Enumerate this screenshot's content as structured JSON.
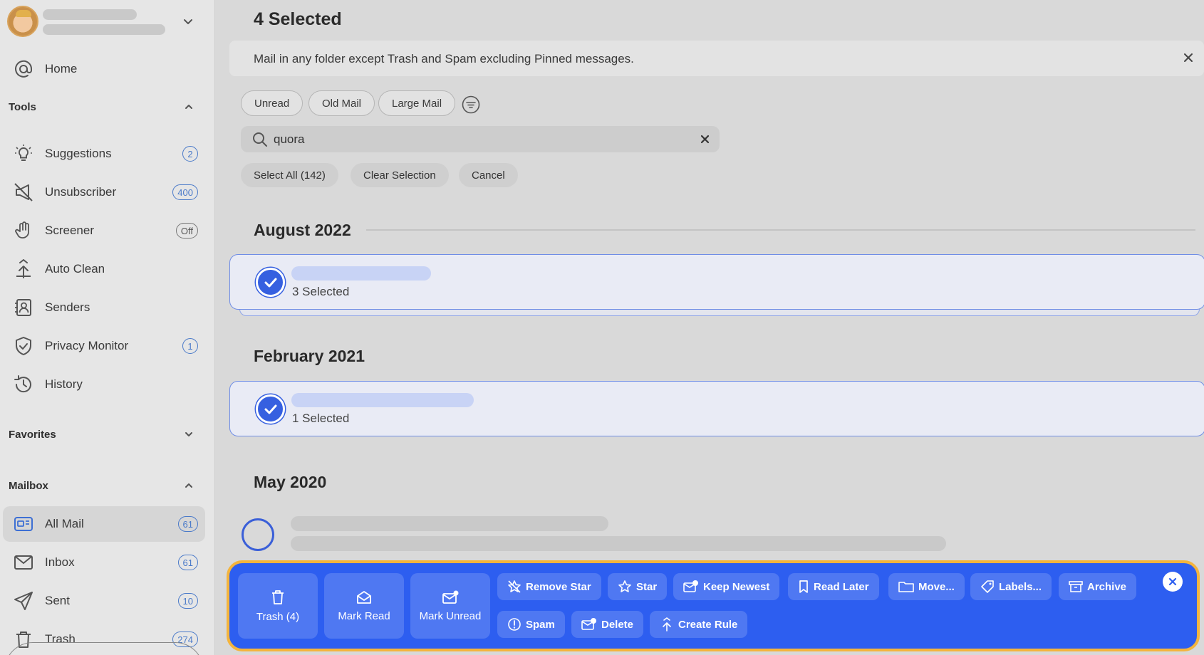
{
  "sidebar": {
    "home": {
      "label": "Home"
    },
    "tools": {
      "heading": "Tools",
      "items": [
        {
          "label": "Suggestions",
          "badge": "2"
        },
        {
          "label": "Unsubscriber",
          "badge": "400"
        },
        {
          "label": "Screener",
          "badge": "Off"
        },
        {
          "label": "Auto Clean",
          "badge": ""
        },
        {
          "label": "Senders",
          "badge": ""
        },
        {
          "label": "Privacy Monitor",
          "badge": "1"
        },
        {
          "label": "History",
          "badge": ""
        }
      ]
    },
    "favorites": {
      "heading": "Favorites"
    },
    "mailbox": {
      "heading": "Mailbox",
      "items": [
        {
          "label": "All Mail",
          "badge": "61"
        },
        {
          "label": "Inbox",
          "badge": "61"
        },
        {
          "label": "Sent",
          "badge": "10"
        },
        {
          "label": "Trash",
          "badge": "274"
        }
      ]
    }
  },
  "main": {
    "title": "4 Selected",
    "banner_text": "Mail in any folder except Trash and Spam excluding Pinned messages.",
    "filters": [
      "Unread",
      "Old Mail",
      "Large Mail"
    ],
    "search": {
      "value": "quora"
    },
    "selection_actions": [
      "Select All (142)",
      "Clear Selection",
      "Cancel"
    ],
    "groups": [
      {
        "heading": "August 2022",
        "count_label": "3 Selected"
      },
      {
        "heading": "February 2021",
        "count_label": "1 Selected"
      },
      {
        "heading": "May 2020"
      }
    ]
  },
  "actions": {
    "trash": "Trash (4)",
    "mark_read": "Mark Read",
    "mark_unread": "Mark Unread",
    "remove_star": "Remove Star",
    "star": "Star",
    "keep_newest": "Keep Newest",
    "read_later": "Read Later",
    "move": "Move...",
    "labels": "Labels...",
    "archive": "Archive",
    "spam": "Spam",
    "delete": "Delete",
    "create_rule": "Create Rule"
  },
  "colors": {
    "accent": "#2d5ef0",
    "highlight_border": "#f4b43d",
    "badge_blue": "#4a7ac9",
    "selected_card": "#e9ebf5"
  }
}
